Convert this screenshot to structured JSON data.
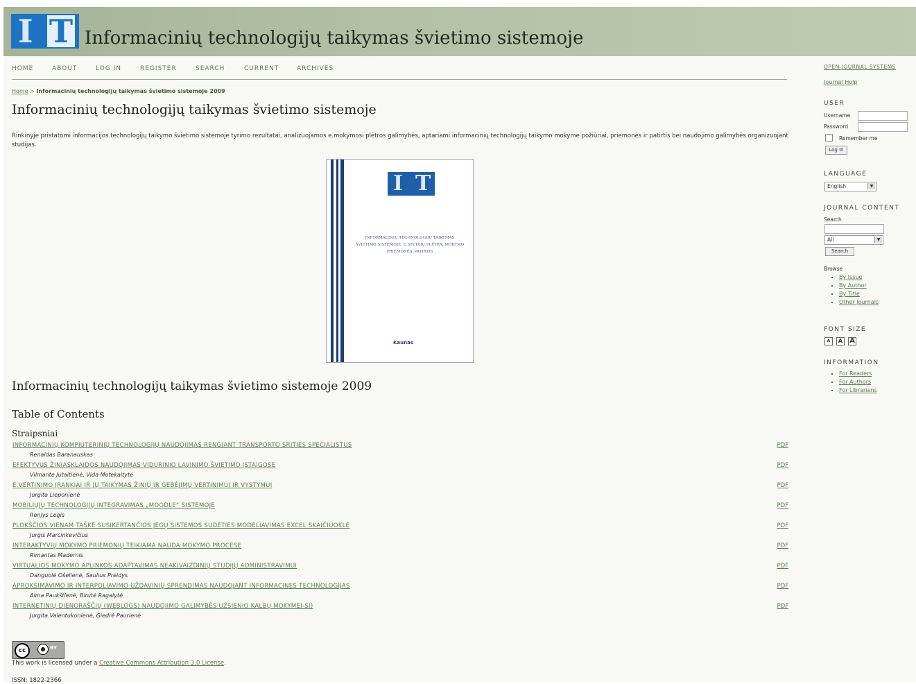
{
  "header": {
    "logo_text_1": "I",
    "logo_text_2": "T",
    "site_title": "Informacinių technologijų taikymas švietimo sistemoje"
  },
  "nav": {
    "home": "HOME",
    "about": "ABOUT",
    "login": "LOG IN",
    "register": "REGISTER",
    "search": "SEARCH",
    "current": "CURRENT",
    "archives": "ARCHIVES"
  },
  "breadcrumb": {
    "home": "Home",
    "sep": " > ",
    "current": "Informacinių technologijų taikymas švietimo sistemoje 2009"
  },
  "main": {
    "title": "Informacinių technologijų taikymas švietimo sistemoje",
    "description": "Rinkinyje pristatomi informacijos technologijų taikymo švietimo sistemoje tyrimo rezultatai, analizuojamos e.mokymosi plėtros galimybės, aptariami informacinių technologijų taikymo mokyme požiūriai, priemonės ir patirtis bei naudojimo galimybės organizuojant studijas.",
    "issue_title": "Informacinių technologijų taikymas švietimo sistemoje 2009",
    "toc_heading": "Table of Contents",
    "section_heading": "Straipsniai"
  },
  "cover": {
    "logo_1": "I",
    "logo_2": "T",
    "title_lines": "INFORMACINIŲ TECHNOLOGIJŲ TAIKYMAS ŠVIETIMO SISTEMOJE: E.STUDIJŲ PLĖTRA, MOKYMO PRIEMONĖS, PATIRTIS",
    "publisher": "Kaunas"
  },
  "articles": [
    {
      "title": "Informacinių kompiuterinių technologijų naudojimas rengiant transporto srities specialistus",
      "authors": "Renaldas Baranauskas",
      "pdf": "PDF"
    },
    {
      "title": "Efektyvus žiniasklaidos naudojimas vidurinio lavinimo švietimo įstaigose",
      "authors": "Vilmante Jutaitienė, Vida Motekaitytė",
      "pdf": "PDF"
    },
    {
      "title": "E.vertinimo įrankiai ir jų taikymas žinių ir gebėjimų vertinimui ir vystymui",
      "authors": "Jurgita Lieponienė",
      "pdf": "PDF"
    },
    {
      "title": "Mobiliųjų technologijų integravimas „Moodle“ sistemoje",
      "authors": "Renjys Legis",
      "pdf": "PDF"
    },
    {
      "title": "Plokščios vienam taške susikertančios jėgų sistemos sudėties modeliavimas Excel skaičiuoklė",
      "authors": "Jurgis Marcinkevičius",
      "pdf": "PDF"
    },
    {
      "title": "Interaktyvių mokymo priemonių teikiama nauda mokymo procese",
      "authors": "Rimantas Madernis",
      "pdf": "PDF"
    },
    {
      "title": "Virtualios mokymo aplinkos adaptavimas neakivaizdinių studijų administravimui",
      "authors": "Danguolė Ošelienė, Saulius Preidys",
      "pdf": "PDF"
    },
    {
      "title": "Aproksimavimo ir interpoliavimo uždavinių sprendimas naudojant informacines technologijas",
      "authors": "Alma Paukštienė, Birutė Ragalytė",
      "pdf": "PDF"
    },
    {
      "title": "Internetinių dienoraščių (weblogs) naudojimo galimybės užsienio kalbų mokymei-si)",
      "authors": "Jurgita Valentukonienė, Giedrė Paurienė",
      "pdf": "PDF"
    }
  ],
  "footer": {
    "cc_badge": "cc",
    "cc_by": "BY",
    "license_prefix": "This work is licensed under a ",
    "license_link": "Creative Commons Attribution 3.0 License",
    "license_suffix": ".",
    "issn": "ISSN: 1822-2366"
  },
  "sidebar": {
    "ojs_link": "OPEN JOURNAL SYSTEMS",
    "help_link": "Journal Help",
    "user_heading": "USER",
    "username_label": "Username",
    "password_label": "Password",
    "remember_label": "Remember me",
    "login_button": "Log In",
    "language_heading": "LANGUAGE",
    "language_value": "English",
    "journal_content_heading": "JOURNAL CONTENT",
    "search_label": "Search",
    "search_scope": "All",
    "search_button": "Search",
    "browse_label": "Browse",
    "browse_items": [
      "By Issue",
      "By Author",
      "By Title",
      "Other Journals"
    ],
    "font_size_heading": "FONT SIZE",
    "font_buttons": [
      "A",
      "A",
      "A"
    ],
    "information_heading": "INFORMATION",
    "information_items": [
      "For Readers",
      "For Authors",
      "For Librarians"
    ]
  },
  "colors": {
    "header_bg": "#b4c1a6",
    "link": "#5c7b56",
    "logo_blue": "#1e73c4",
    "page_bg": "#f8f8f4"
  }
}
